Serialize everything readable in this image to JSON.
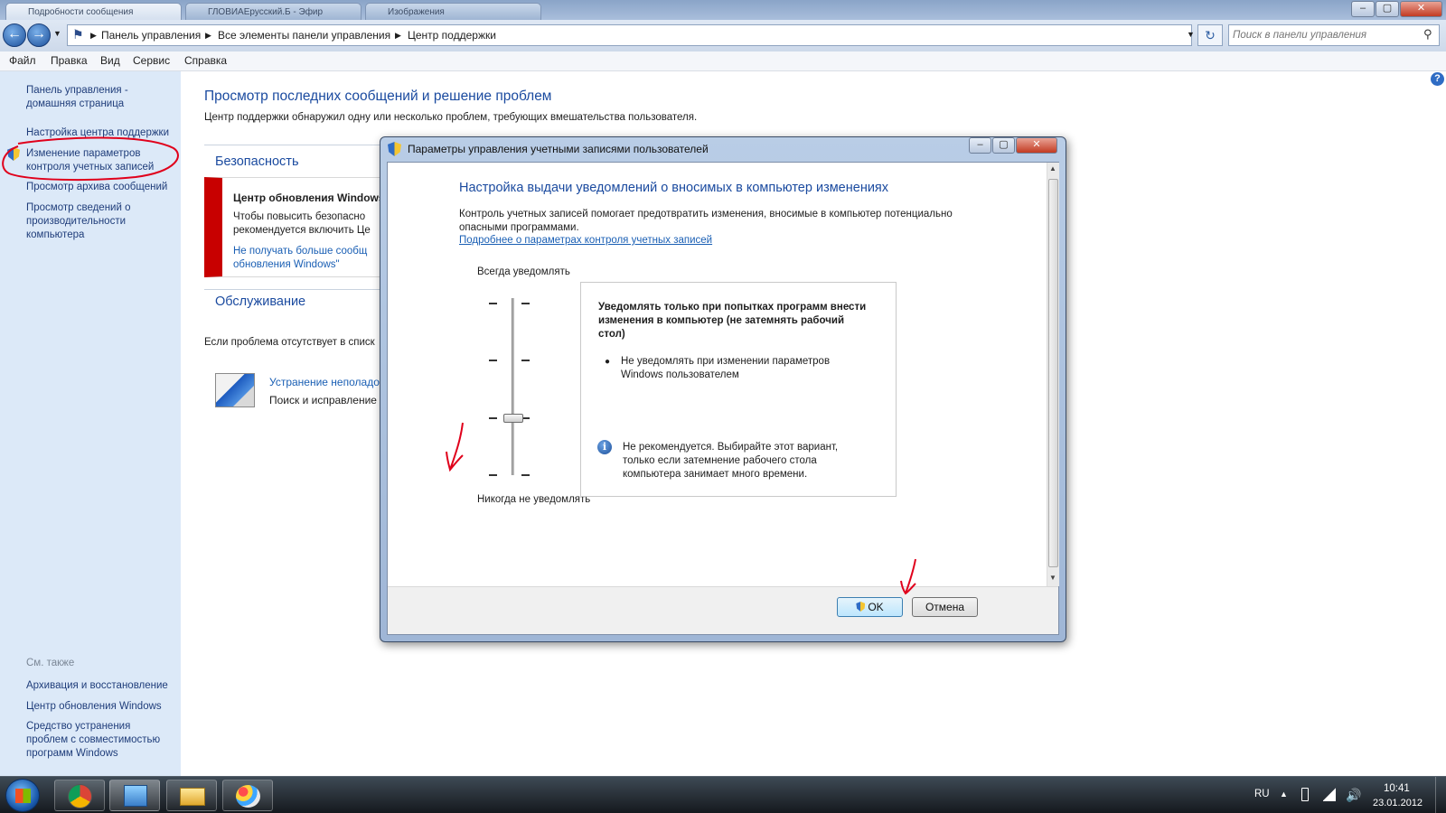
{
  "window": {
    "tabs": [
      "Подробности сообщения",
      "ГЛОВИАЕрусский.Б - Эфир",
      "Изображения"
    ],
    "buttons": {
      "minimize": "–",
      "maximize": "▢",
      "close": "✕"
    }
  },
  "address": {
    "back_icon": "back-arrow-icon",
    "forward_icon": "forward-arrow-icon",
    "breadcrumbs": [
      "Панель управления",
      "Все элементы панели управления",
      "Центр поддержки"
    ],
    "search_placeholder": "Поиск в панели управления"
  },
  "menu": [
    "Файл",
    "Правка",
    "Вид",
    "Сервис",
    "Справка"
  ],
  "sidebar": {
    "items": [
      {
        "line1": "Панель управления -",
        "line2": "домашняя страница"
      },
      {
        "line1": "Настройка центра поддержки",
        "line2": ""
      },
      {
        "line1": "Изменение параметров",
        "line2": "контроля учетных записей"
      },
      {
        "line1": "Просмотр архива сообщений",
        "line2": ""
      },
      {
        "line1": "Просмотр сведений о",
        "line2": "производительности",
        "line3": "компьютера"
      }
    ],
    "see_also_label": "См. также",
    "see_also": [
      {
        "line1": "Архивация и восстановление"
      },
      {
        "line1": "Центр обновления Windows"
      },
      {
        "line1": "Средство устранения",
        "line2": "проблем с совместимостью",
        "line3": "программ Windows"
      }
    ]
  },
  "main": {
    "title": "Просмотр последних сообщений и решение проблем",
    "subtitle": "Центр поддержки обнаружил одну или несколько проблем, требующих вмешательства пользователя.",
    "security": {
      "heading": "Безопасность",
      "alert_title": "Центр обновления Windows",
      "alert_text1": "Чтобы повысить безопасно",
      "alert_text2": "рекомендуется включить Це",
      "alert_link1": "Не получать больше сообщ",
      "alert_link2": "обновления Windows\""
    },
    "maintenance": {
      "heading": "Обслуживание"
    },
    "problem_text": "Если проблема отсутствует в списк",
    "troubleshoot_link": "Устранение неполадо",
    "troubleshoot_desc": "Поиск и исправление"
  },
  "dialog": {
    "title": "Параметры управления учетными записями пользователей",
    "heading": "Настройка выдачи уведомлений о вносимых в компьютер изменениях",
    "desc_line1": "Контроль учетных записей помогает предотвратить изменения, вносимые в компьютер потенциально",
    "desc_line2": "опасными программами.",
    "link": "Подробнее о параметрах контроля учетных записей",
    "slider_top": "Всегда уведомлять",
    "slider_bottom": "Никогда не уведомлять",
    "slider_level": 2,
    "slider_levels_total": 4,
    "info_title_l1": "Уведомлять только при попытках программ внести",
    "info_title_l2": "изменения в компьютер (не затемнять рабочий",
    "info_title_l3": "стол)",
    "bullet_l1": "Не уведомлять при изменении параметров",
    "bullet_l2": "Windows пользователем",
    "note_l1": "Не рекомендуется. Выбирайте этот вариант,",
    "note_l2": "только если затемнение рабочего стола",
    "note_l3": "компьютера занимает много времени.",
    "ok": "OK",
    "cancel": "Отмена"
  },
  "taskbar": {
    "lang": "RU",
    "time": "10:41",
    "date": "23.01.2012"
  },
  "colors": {
    "accent": "#1a4a9f",
    "alert": "#c80000",
    "annotation": "#e0001b",
    "sidebar": "#dce9f8"
  }
}
